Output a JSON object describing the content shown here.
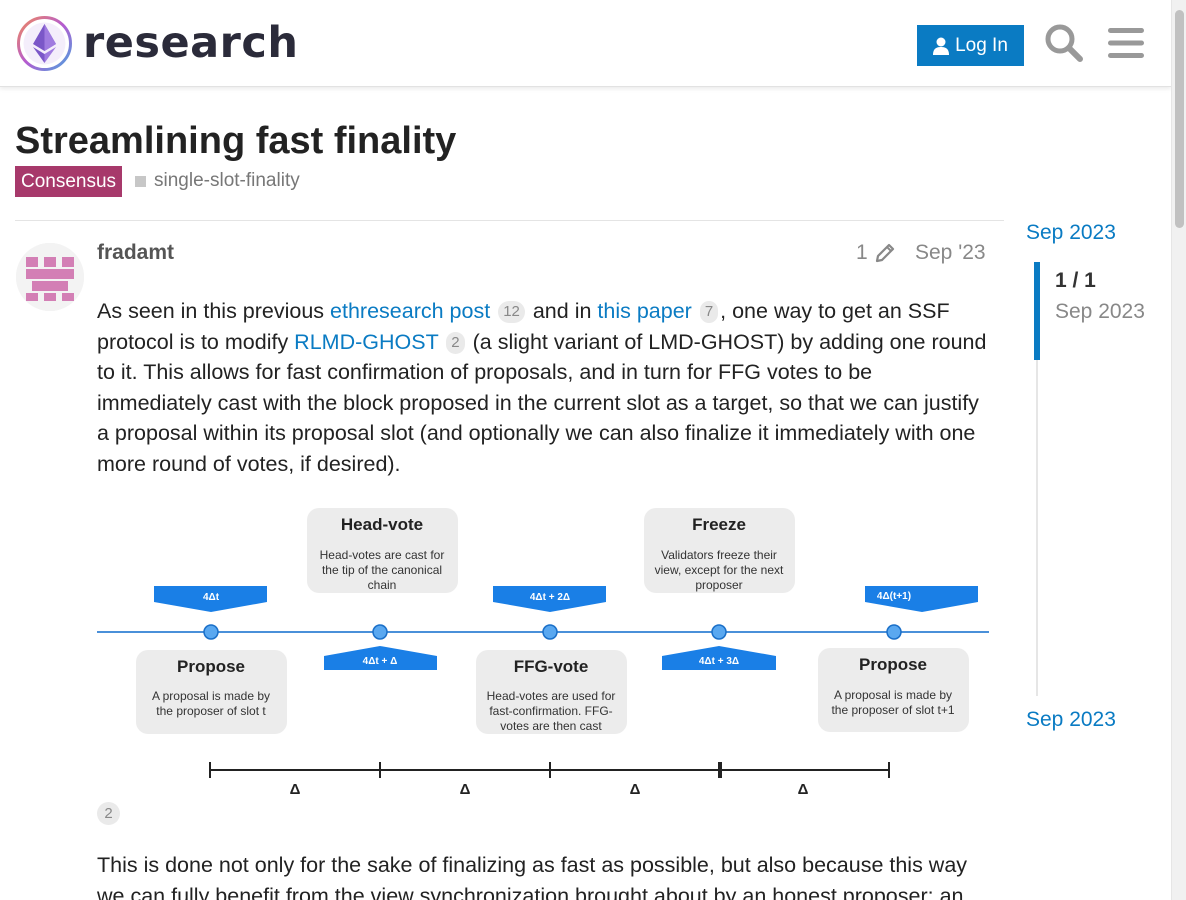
{
  "header": {
    "site_name": "research",
    "login_label": "Log In",
    "icons": [
      "search-icon",
      "menu-icon",
      "user-icon"
    ]
  },
  "topic": {
    "title": "Streamlining fast finality",
    "category": "Consensus",
    "category_color": "#a7396b",
    "tag": "single-slot-finality"
  },
  "post": {
    "username": "fradamt",
    "edit_count": "1",
    "date": "Sep '23",
    "p1": {
      "t1": "As seen in this previous ",
      "link1": "ethresearch post",
      "link1_clicks": "12",
      "t2": " and in ",
      "link2": "this paper",
      "link2_clicks": "7",
      "t3": ", one way to get an SSF protocol is to modify ",
      "link3": "RLMD-GHOST",
      "link3_clicks": "2",
      "t4": " (a slight variant of LMD-GHOST) by adding one round to it. This allows for fast confirmation of proposals, and in turn for FFG votes to be immediately cast with the block proposed in the current slot as a target, so that we can justify a proposal within its proposal slot (and optionally we can also finalize it immediately with one more round of votes, if desired)."
    },
    "image_clicks": "2",
    "p2": "This is done not only for the sake of finalizing as fast as possible, but also because this way we can fully benefit from the view synchronization brought about by an honest proposer: an"
  },
  "diagram": {
    "top_boxes": [
      {
        "title": "Head-vote",
        "lines": [
          "Head-votes are cast for",
          "the tip of the canonical",
          "chain"
        ]
      },
      {
        "title": "Freeze",
        "lines": [
          "Validators freeze their",
          "view, except for the next",
          "proposer"
        ]
      }
    ],
    "bottom_boxes": [
      {
        "title": "Propose",
        "lines": [
          "A proposal is made by",
          "the proposer of slot t"
        ]
      },
      {
        "title": "FFG-vote",
        "lines": [
          "Head-votes are used for",
          "fast-confirmation. FFG-",
          "votes are then cast"
        ]
      },
      {
        "title": "Propose",
        "lines": [
          "A proposal is made by",
          "the proposer of slot t+1"
        ]
      }
    ],
    "top_markers": [
      "4Δt",
      "4Δt + 2Δ",
      "4Δ(t+1)"
    ],
    "bottom_markers": [
      "4Δt + Δ",
      "4Δt + 3Δ"
    ],
    "delta_labels": [
      "Δ",
      "Δ",
      "Δ",
      "Δ"
    ],
    "accent_color": "#1a7fe6"
  },
  "timeline": {
    "top_date": "Sep 2023",
    "count": "1 / 1",
    "handle_date": "Sep 2023",
    "bottom_date": "Sep 2023"
  },
  "colors": {
    "link": "#0a7bc3",
    "button": "#0a7bc3"
  }
}
